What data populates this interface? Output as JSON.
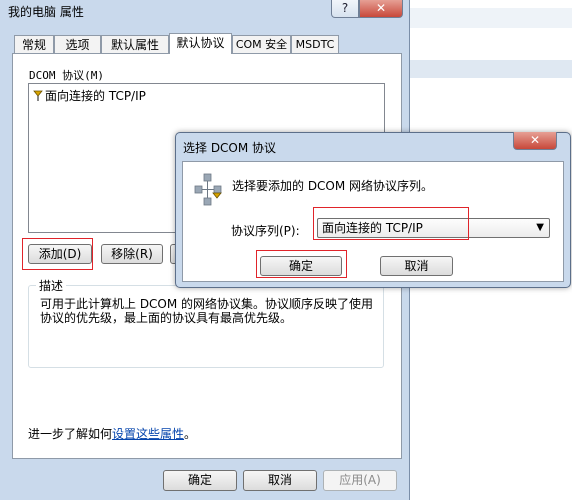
{
  "window": {
    "title": "我的电脑 属性",
    "help_label": "?",
    "close_label": "✕"
  },
  "tabs": [
    {
      "label": "常规"
    },
    {
      "label": "选项"
    },
    {
      "label": "默认属性"
    },
    {
      "label": "默认协议"
    },
    {
      "label": "COM 安全"
    },
    {
      "label": "MSDTC"
    }
  ],
  "active_tab": "默认协议",
  "protocol_panel": {
    "list_label": "DCOM 协议(M)",
    "items": [
      {
        "label": "面向连接的 TCP/IP",
        "icon": "network-protocol-icon"
      }
    ],
    "add_button": "添加(D)",
    "remove_button": "移除(R)",
    "description_title": "描述",
    "description_text": "可用于此计算机上 DCOM 的网络协议集。协议顺序反映了使用协议的优先级，最上面的协议具有最高优先级。",
    "learn_more_prefix": "进一步了解如何",
    "learn_more_link": "设置这些属性",
    "learn_more_suffix": "。"
  },
  "footer": {
    "ok": "确定",
    "cancel": "取消",
    "apply": "应用(A)"
  },
  "modal": {
    "title": "选择 DCOM 协议",
    "close_label": "✕",
    "prompt": "选择要添加的 DCOM 网络协议序列。",
    "field_label": "协议序列(P):",
    "selected_value": "面向连接的 TCP/IP",
    "ok": "确定",
    "cancel": "取消"
  },
  "colors": {
    "highlight": "#e0242a",
    "link": "#0645ad"
  }
}
